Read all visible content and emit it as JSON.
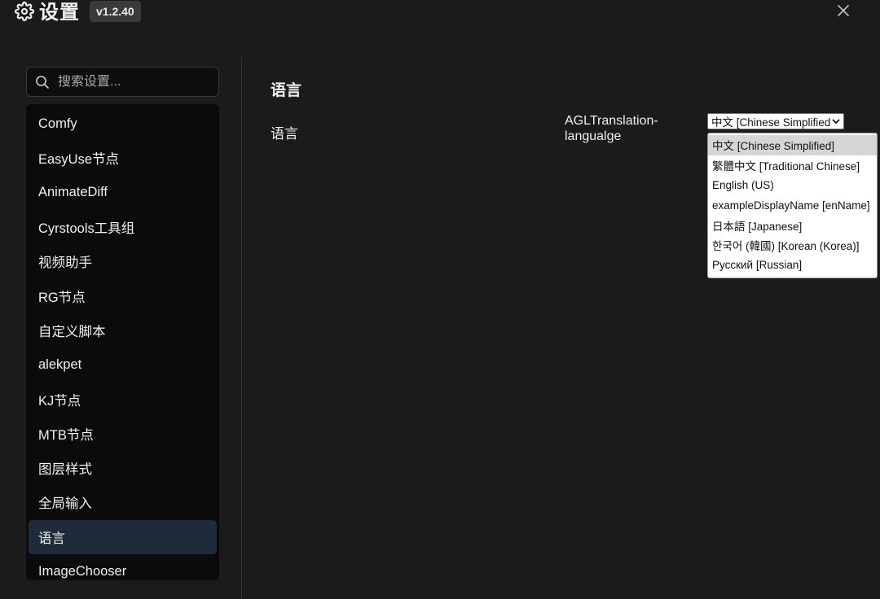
{
  "header": {
    "title": "设置",
    "version": "v1.2.40",
    "gear_icon": "gear-icon",
    "close_icon": "close-icon"
  },
  "search": {
    "placeholder": "搜索设置...",
    "value": ""
  },
  "sidebar": {
    "items": [
      {
        "label": "Comfy"
      },
      {
        "label": "EasyUse节点"
      },
      {
        "label": "AnimateDiff"
      },
      {
        "label": "Cyrstools工具组"
      },
      {
        "label": "视频助手"
      },
      {
        "label": "RG节点"
      },
      {
        "label": "自定义脚本"
      },
      {
        "label": "alekpet"
      },
      {
        "label": "KJ节点"
      },
      {
        "label": "MTB节点"
      },
      {
        "label": "图层样式"
      },
      {
        "label": "全局输入"
      },
      {
        "label": "语言"
      },
      {
        "label": "ImageChooser"
      }
    ],
    "active_index": 12
  },
  "main": {
    "section_title": "语言",
    "setting": {
      "label": "语言",
      "id_line1": "AGLTranslation-",
      "id_line2": "langualge",
      "selected_value": "中文 [Chinese Simplified]"
    },
    "dropdown_options": [
      "中文 [Chinese Simplified]",
      "繁體中文 [Traditional Chinese]",
      "English (US)",
      "exampleDisplayName [enName]",
      "日本語 [Japanese]",
      "한국어 (韓國) [Korean (Korea)]",
      "Русский [Russian]"
    ]
  },
  "colors": {
    "background": "#1b1b1c",
    "sidebar_bg": "#0b0b0c",
    "active_item": "#1f2b3a",
    "badge_bg": "#3a3a3c"
  }
}
